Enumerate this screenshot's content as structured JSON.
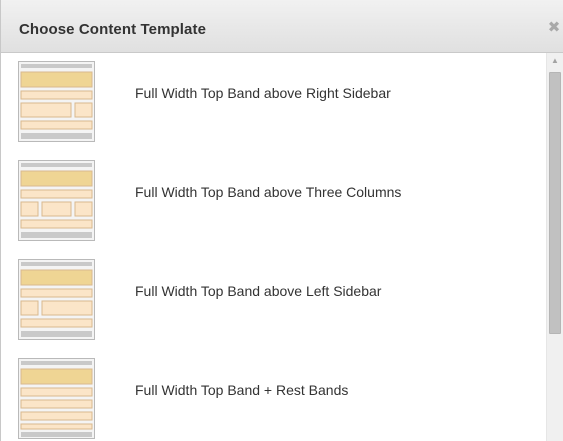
{
  "dialog": {
    "title": "Choose Content Template",
    "close_icon": "close-icon",
    "close_glyph": "✖"
  },
  "templates": [
    {
      "label": "Full Width Top Band above Right Sidebar",
      "layout": "right-sidebar"
    },
    {
      "label": "Full Width Top Band above Three Columns",
      "layout": "three-columns"
    },
    {
      "label": "Full Width Top Band above Left Sidebar",
      "layout": "left-sidebar"
    },
    {
      "label": "Full Width Top Band + Rest Bands",
      "layout": "rest-bands"
    }
  ],
  "scrollbar": {
    "up_glyph": "▲"
  },
  "colors": {
    "band_top": "#efd594",
    "band_light": "#fbe5c8",
    "band_border": "#d9b98e",
    "frame_gray": "#c9c9c9"
  }
}
